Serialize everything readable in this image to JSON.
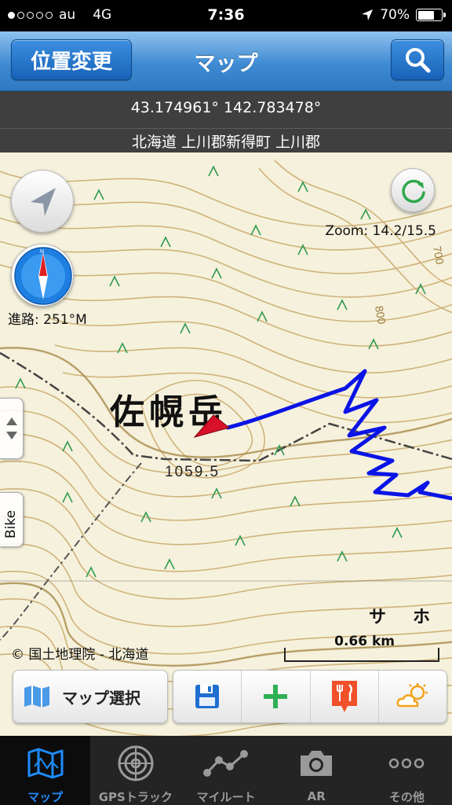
{
  "status_bar": {
    "carrier": "au",
    "network": "4G",
    "time": "7:36",
    "battery": "70%",
    "battery_level": 0.7,
    "signal_bars_filled": 1,
    "signal_bars_total": 5
  },
  "nav": {
    "left_button": "位置変更",
    "title": "マップ",
    "search_icon": "search-icon"
  },
  "info": {
    "coordinates": "43.174961° 142.783478°",
    "address": "北海道 上川郡新得町 上川郡"
  },
  "map": {
    "heading": "進路: 251°M",
    "zoom": "Zoom: 14.2/15.5",
    "peak_name": "佐幌岳",
    "elevation": "1059.5",
    "map_label_sa": "サ",
    "map_label_ho": "ホ",
    "contour_label_700": "700",
    "contour_label_800": "800",
    "copyright": "© 国土地理院 - 北海道",
    "scale": "0.66 km",
    "side_tab_label": "Bike",
    "track_color": "#0a14e6",
    "marker_color": "#d8102a"
  },
  "toolbar": {
    "map_select": "マップ選択",
    "icons": [
      "save-icon",
      "add-icon",
      "restaurant-icon",
      "weather-icon"
    ]
  },
  "tabs": [
    {
      "label": "マップ",
      "icon": "map-icon",
      "active": true
    },
    {
      "label": "GPSトラック",
      "icon": "radar-icon",
      "active": false
    },
    {
      "label": "マイルート",
      "icon": "route-icon",
      "active": false
    },
    {
      "label": "AR",
      "icon": "camera-icon",
      "active": false
    },
    {
      "label": "その他",
      "icon": "more-icon",
      "active": false
    }
  ]
}
